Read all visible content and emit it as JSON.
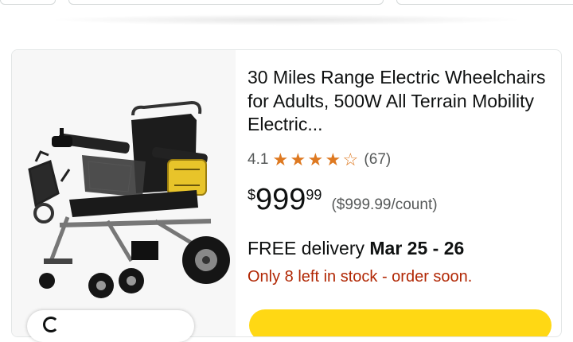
{
  "product": {
    "title": "30 Miles Range Electric Wheelchairs for Adults, 500W All Terrain Mobility Electric...",
    "rating_value": "4.1",
    "rating_stars": 4.1,
    "rating_count": "(67)",
    "price_currency": "$",
    "price_whole": "999",
    "price_fraction": "99",
    "unit_price": "($999.99/count)",
    "delivery_prefix": "FREE delivery",
    "delivery_dates": "Mar 25 - 26",
    "stock_message": "Only 8 left in stock - order soon.",
    "image_icon": "wheelchair-product-image"
  },
  "colors": {
    "star": "#de7921",
    "stock_red": "#b12704",
    "cart_button": "#ffd814",
    "text": "#0f1111",
    "muted": "#565959"
  }
}
